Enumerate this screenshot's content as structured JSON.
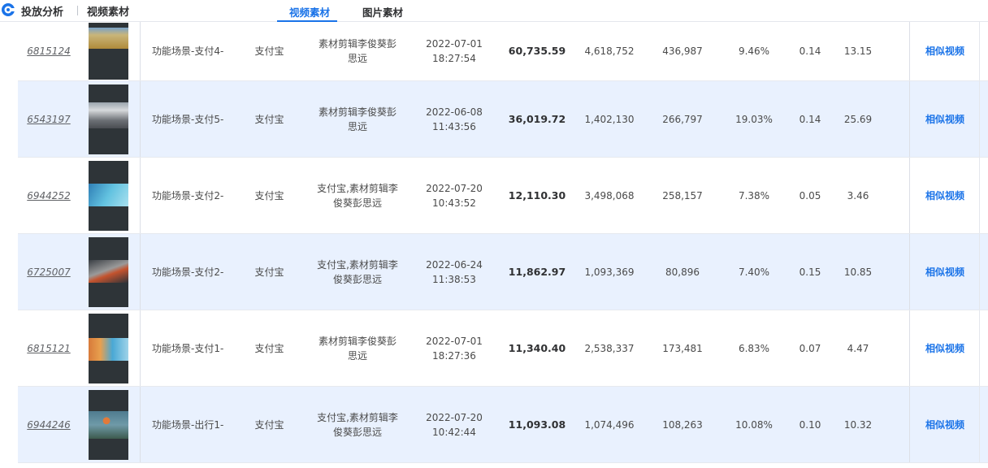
{
  "header": {
    "brand": "投放分析",
    "crumb": "视频素材",
    "tabs": [
      {
        "label": "视频素材",
        "active": true
      },
      {
        "label": "图片素材",
        "active": false
      }
    ],
    "accent_color": "#1a73e8"
  },
  "rows": [
    {
      "id": "6815124",
      "name": "功能场景-支付4-",
      "platform": "支付宝",
      "tag": "素材剪辑李俊葵彭思远",
      "date": "2022-07-01 18:27:54",
      "cost": "60,735.59",
      "impressions": "4,618,752",
      "clicks": "436,987",
      "ctr": "9.46%",
      "cvr": "0.14",
      "cpa": "13.15",
      "action": "相似视频",
      "thumb": "field"
    },
    {
      "id": "6543197",
      "name": "功能场景-支付5-",
      "platform": "支付宝",
      "tag": "素材剪辑李俊葵彭思远",
      "date": "2022-06-08 11:43:56",
      "cost": "36,019.72",
      "impressions": "1,402,130",
      "clicks": "266,797",
      "ctr": "19.03%",
      "cvr": "0.14",
      "cpa": "25.69",
      "action": "相似视频",
      "thumb": "crowd"
    },
    {
      "id": "6944252",
      "name": "功能场景-支付2-",
      "platform": "支付宝",
      "tag": "支付宝,素材剪辑李俊葵彭思远",
      "date": "2022-07-20 10:43:52",
      "cost": "12,110.30",
      "impressions": "3,498,068",
      "clicks": "258,157",
      "ctr": "7.38%",
      "cvr": "0.05",
      "cpa": "3.46",
      "action": "相似视频",
      "thumb": "sky"
    },
    {
      "id": "6725007",
      "name": "功能场景-支付2-",
      "platform": "支付宝",
      "tag": "支付宝,素材剪辑李俊葵彭思远",
      "date": "2022-06-24 11:38:53",
      "cost": "11,862.97",
      "impressions": "1,093,369",
      "clicks": "80,896",
      "ctr": "7.40%",
      "cvr": "0.15",
      "cpa": "10.85",
      "action": "相似视频",
      "thumb": "train"
    },
    {
      "id": "6815121",
      "name": "功能场景-支付1-",
      "platform": "支付宝",
      "tag": "素材剪辑李俊葵彭思远",
      "date": "2022-07-01 18:27:36",
      "cost": "11,340.40",
      "impressions": "2,538,337",
      "clicks": "173,481",
      "ctr": "6.83%",
      "cvr": "0.07",
      "cpa": "4.47",
      "action": "相似视频",
      "thumb": "sunset"
    },
    {
      "id": "6944246",
      "name": "功能场景-出行1-",
      "platform": "支付宝",
      "tag": "支付宝,素材剪辑李俊葵彭思远",
      "date": "2022-07-20 10:42:44",
      "cost": "11,093.08",
      "impressions": "1,074,496",
      "clicks": "108,263",
      "ctr": "10.08%",
      "cvr": "0.10",
      "cpa": "10.32",
      "action": "相似视频",
      "thumb": "balloon"
    }
  ]
}
